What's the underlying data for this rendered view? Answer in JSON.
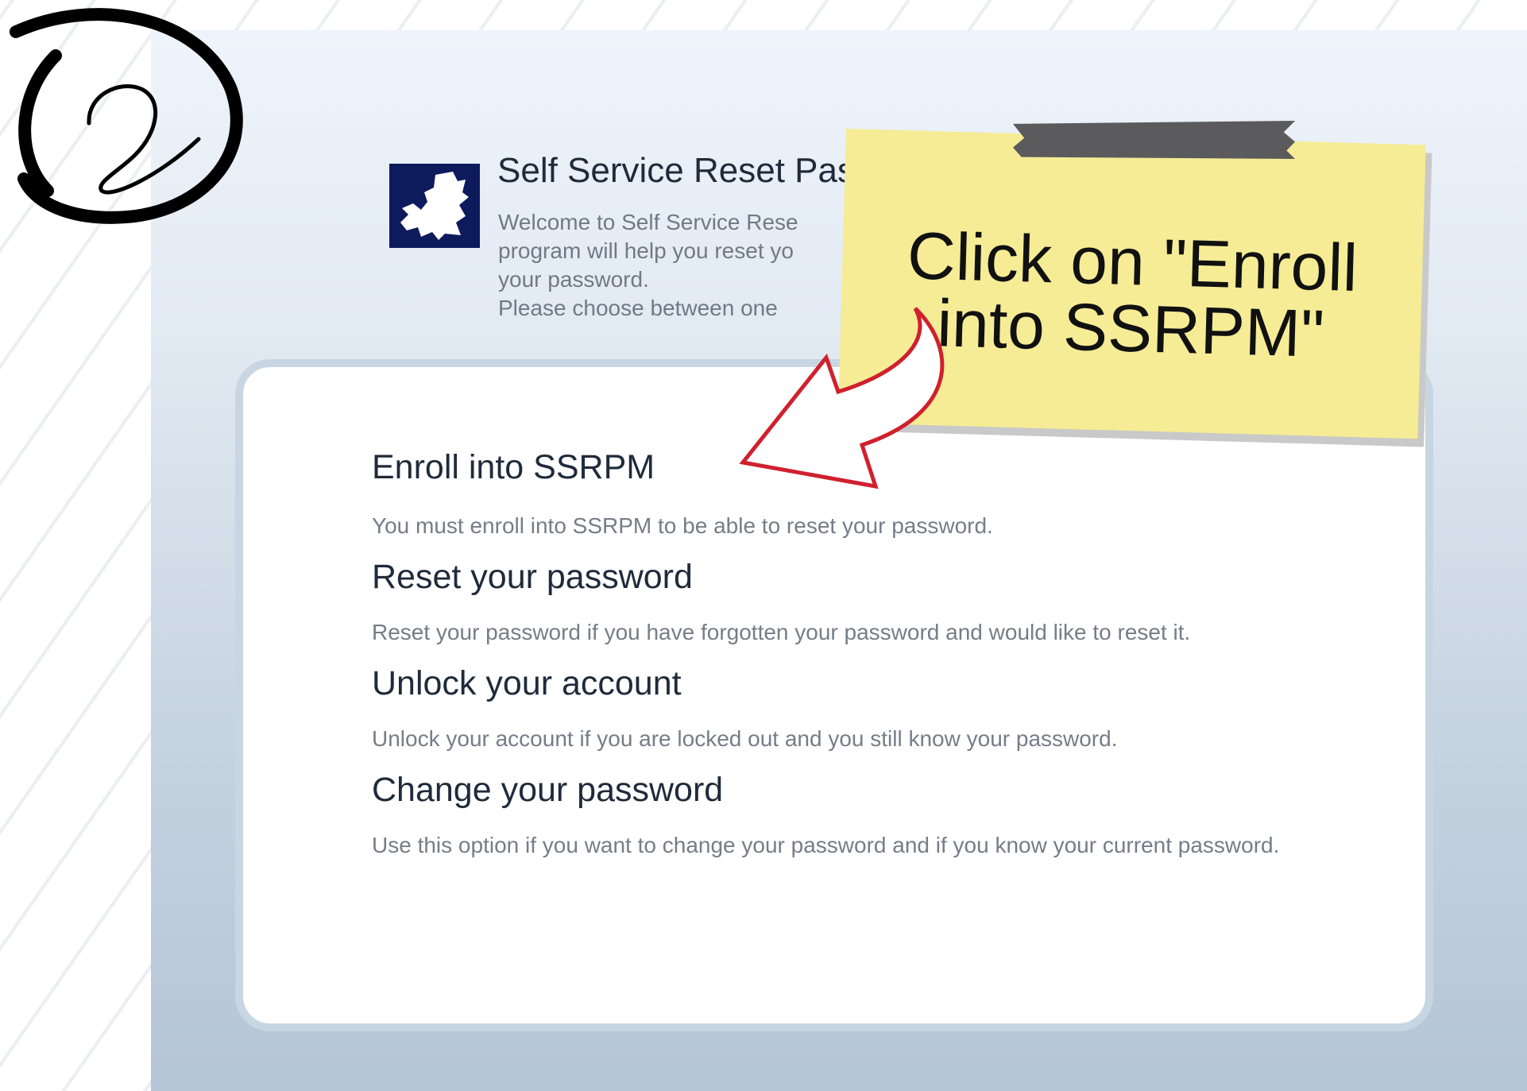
{
  "step_marker": {
    "number": "2"
  },
  "app": {
    "title": "Self Service Reset Pas",
    "welcome": {
      "line1": "Welcome to Self Service Rese",
      "line2": "program will help you reset yo",
      "line3": "your password.",
      "line4": "Please choose between one"
    }
  },
  "options": [
    {
      "title": "Enroll into SSRPM",
      "description": "You must enroll into SSRPM to be able to reset your password."
    },
    {
      "title": "Reset your password",
      "description": "Reset your password if you have forgotten your password and would like to reset it."
    },
    {
      "title": "Unlock your account",
      "description": "Unlock your account if you are locked out and you still know your password."
    },
    {
      "title": "Change your password",
      "description": "Use this option if you want to change your password and if you know your current password."
    }
  ],
  "callout": {
    "line1": "Click on \"Enroll",
    "line2": "into SSRPM\""
  },
  "colors": {
    "arrow": "#d0202e",
    "note": "#f5ec95",
    "logo": "#0d1a5c"
  }
}
